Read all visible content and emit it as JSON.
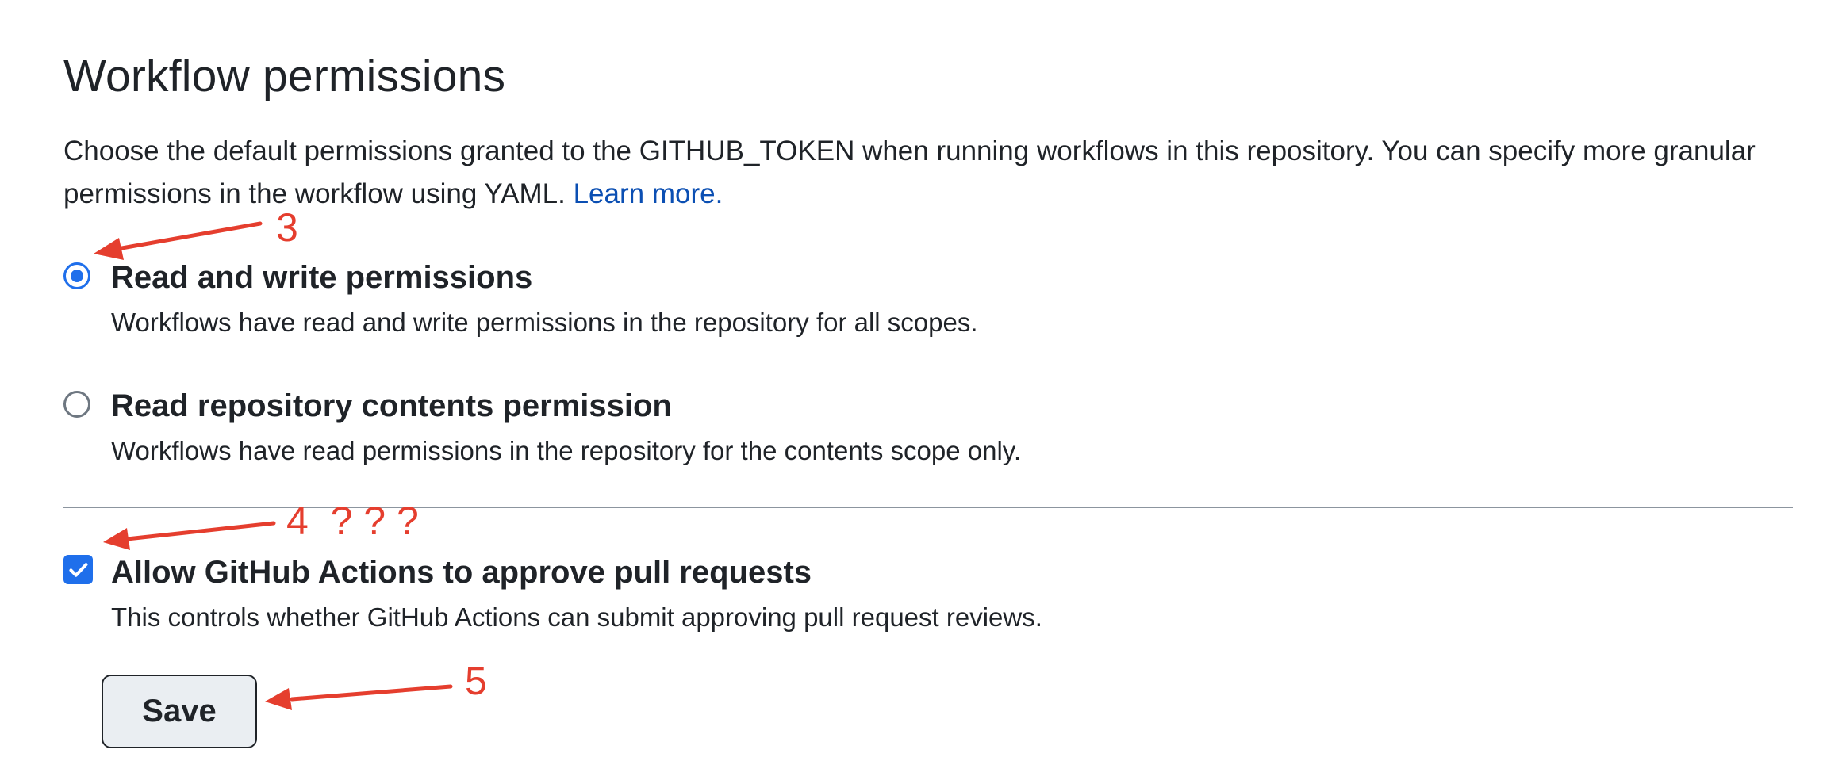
{
  "section": {
    "title": "Workflow permissions",
    "description": "Choose the default permissions granted to the GITHUB_TOKEN when running workflows in this repository. You can specify more granular permissions in the workflow using YAML.",
    "learn_more": "Learn more."
  },
  "options": [
    {
      "label": "Read and write permissions",
      "description": "Workflows have read and write permissions in the repository for all scopes.",
      "selected": true
    },
    {
      "label": "Read repository contents permission",
      "description": "Workflows have read permissions in the repository for the contents scope only.",
      "selected": false
    }
  ],
  "approve_pr": {
    "label": "Allow GitHub Actions to approve pull requests",
    "description": "This controls whether GitHub Actions can submit approving pull request reviews.",
    "checked": true
  },
  "save_button": {
    "label": "Save"
  },
  "annotations": {
    "a3": "3",
    "a4": "4  ? ? ?",
    "a5": "5",
    "color": "#e53e2e"
  },
  "colors": {
    "accent": "#1f6feb",
    "link": "#0b4fb3",
    "text": "#1f2328"
  }
}
